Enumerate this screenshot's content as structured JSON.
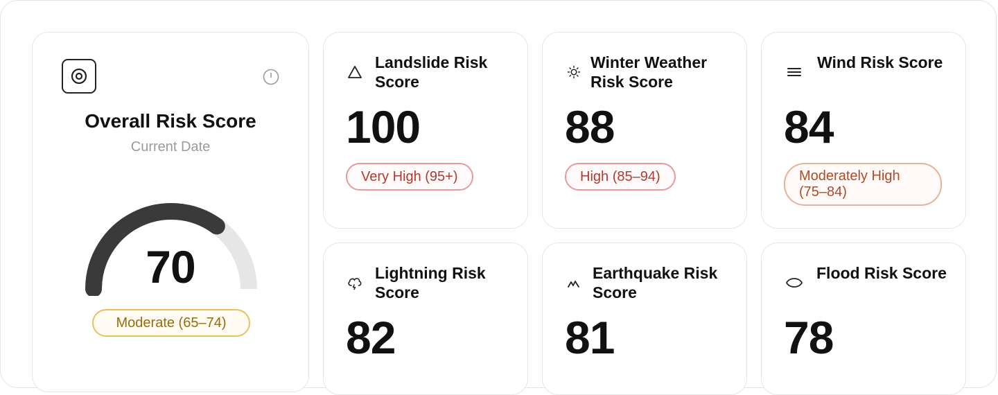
{
  "overall": {
    "title": "Overall Risk Score",
    "subtitle": "Current Date",
    "score": "70",
    "score_fraction": 0.7,
    "rating": "Moderate (65–74)",
    "rating_color": "#e8c15f"
  },
  "cards": [
    {
      "title": "Landslide Risk Score",
      "value": "100",
      "rating": "Very High (95+)",
      "icon": "triangle-icon"
    },
    {
      "title": "Winter Weather Risk Score",
      "value": "88",
      "rating": "High (85–94)",
      "icon": "sun-icon"
    },
    {
      "title": "Wind Risk Score",
      "value": "84",
      "rating": "Moderately High (75–84)",
      "icon": "wind-lines-icon"
    },
    {
      "title": "Lightning Risk Score",
      "value": "82",
      "icon": "storm-cloud-icon"
    },
    {
      "title": "Earthquake Risk Score",
      "value": "81",
      "icon": "seismic-icon"
    },
    {
      "title": "Flood Risk Score",
      "value": "78",
      "icon": "flood-eye-icon"
    }
  ],
  "colors": {
    "very_high": "#b03a30",
    "high": "#b03a30",
    "moderately_high": "#b04a28",
    "moderate": "#9a6b0c"
  }
}
